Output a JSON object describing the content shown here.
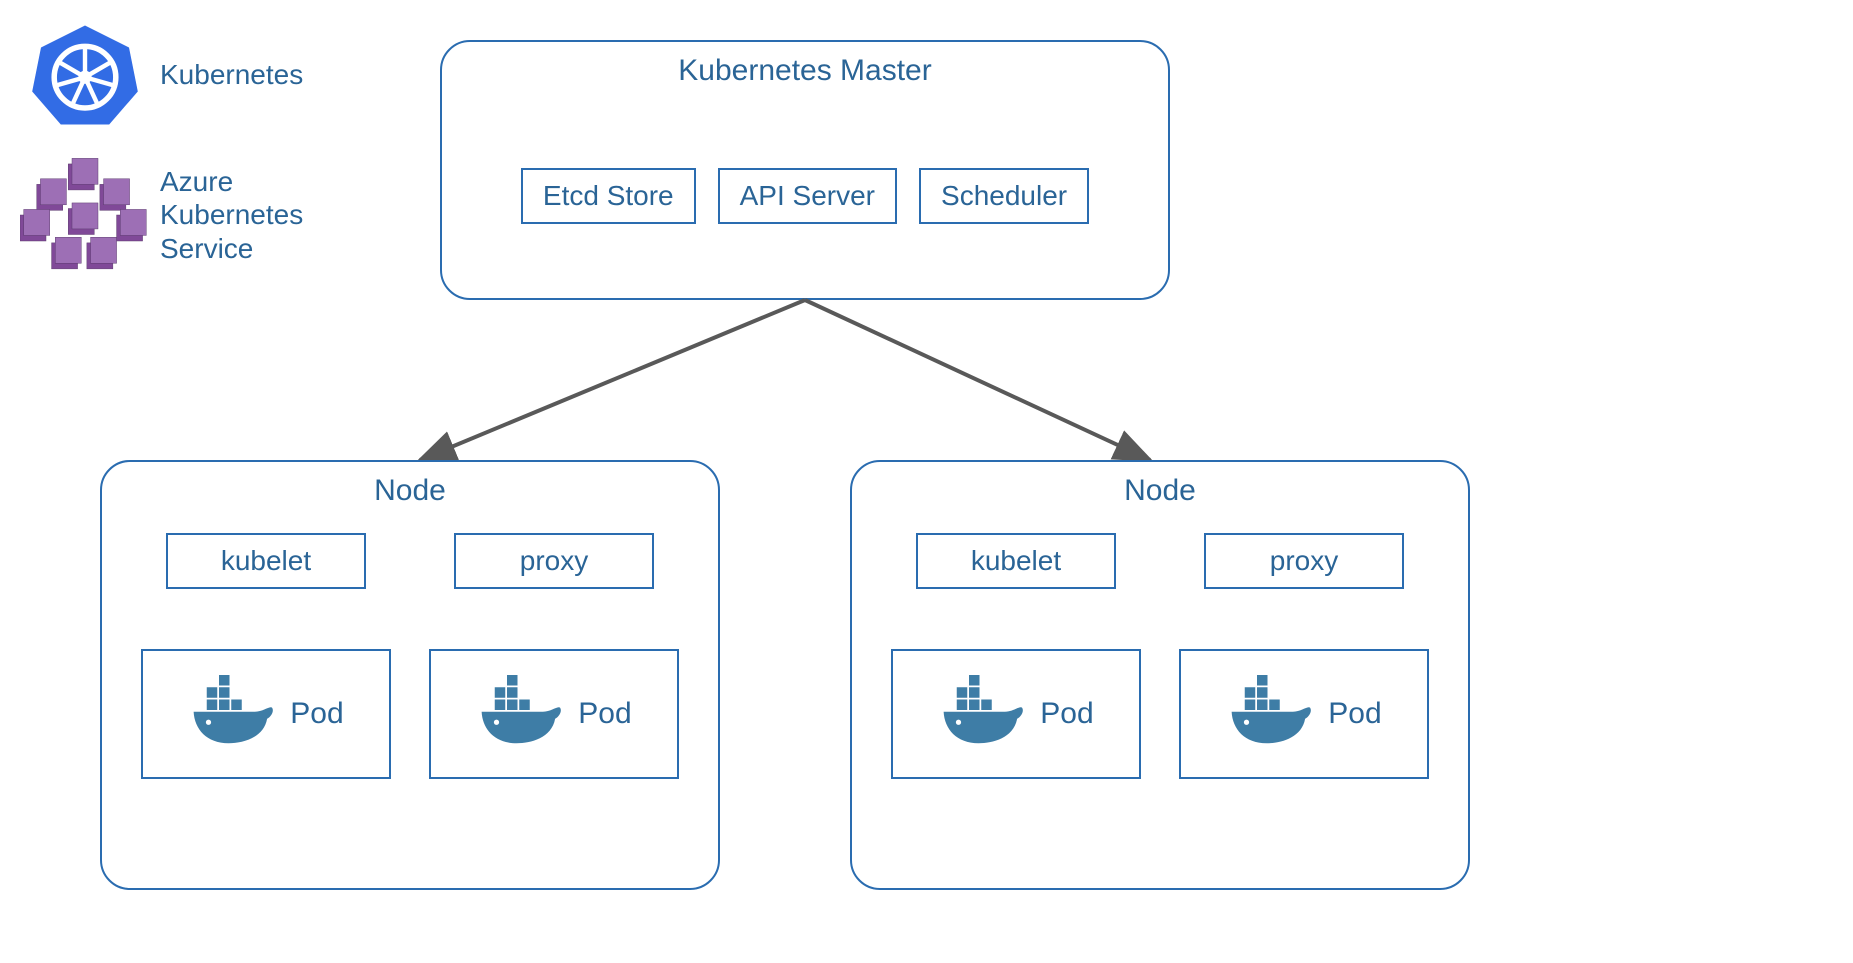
{
  "legend": {
    "kubernetes": "Kubernetes",
    "aks_line1": "Azure",
    "aks_line2": "Kubernetes",
    "aks_line3": "Service"
  },
  "master": {
    "title": "Kubernetes Master",
    "etcd": "Etcd Store",
    "api": "API Server",
    "scheduler": "Scheduler"
  },
  "node": {
    "title": "Node",
    "kubelet": "kubelet",
    "proxy": "proxy",
    "pod": "Pod"
  },
  "icons": {
    "k8s": "kubernetes-icon",
    "aks": "aks-icon",
    "docker": "docker-whale-icon"
  },
  "colors": {
    "border": "#2a6cb0",
    "text": "#2a6496",
    "k8s_blue": "#326ce5",
    "aks_purple": "#804998",
    "docker_blue": "#3e7da6",
    "arrow": "#595959"
  }
}
